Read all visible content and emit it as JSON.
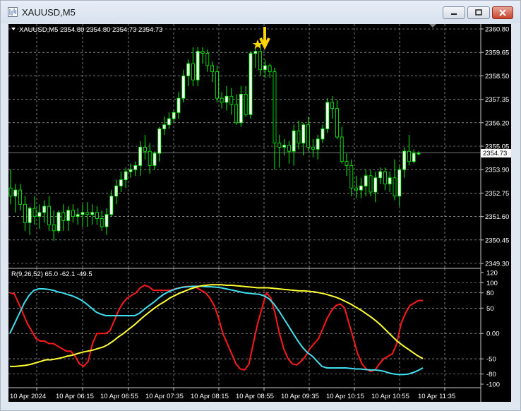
{
  "window": {
    "title": "XAUUSD,M5"
  },
  "info_line": "XAUUSD,M5  2354.80 2354.80 2354.73 2354.73",
  "indicator_label": "R(9,26,52) 65.0 -62.1 -49.5",
  "current_price": "2354.73",
  "colors": {
    "bull": "#ffffff",
    "bear": "#000000",
    "wick": "#00ff00",
    "grid": "#c8c8c8",
    "red_line": "#ff1a1a",
    "cyan_line": "#40e0f0",
    "yellow_line": "#ffff33",
    "marker": "#ffd400"
  },
  "chart_data": [
    {
      "type": "candlestick",
      "symbol": "XAUUSD",
      "timeframe": "M5",
      "y_ticks": [
        "2360.80",
        "2359.65",
        "2358.50",
        "2357.35",
        "2356.20",
        "2355.05",
        "2353.90",
        "2352.75",
        "2351.60",
        "2350.45",
        "2349.30"
      ],
      "ylim": [
        2349.3,
        2360.8
      ],
      "x_ticks": [
        "10 Apr 2024",
        "10 Apr 06:15",
        "10 Apr 06:55",
        "10 Apr 07:35",
        "10 Apr 08:15",
        "10 Apr 08:55",
        "10 Apr 09:35",
        "10 Apr 10:15",
        "10 Apr 10:55",
        "10 Apr 11:35"
      ],
      "candles": [
        [
          2353.0,
          2353.9,
          2352.2,
          2352.6
        ],
        [
          2352.6,
          2353.2,
          2351.8,
          2352.9
        ],
        [
          2352.9,
          2353.2,
          2351.9,
          2352.2
        ],
        [
          2352.2,
          2352.6,
          2350.9,
          2351.3
        ],
        [
          2351.3,
          2352.1,
          2350.7,
          2352.0
        ],
        [
          2352.0,
          2352.6,
          2351.2,
          2351.6
        ],
        [
          2351.6,
          2352.2,
          2351.0,
          2351.8
        ],
        [
          2351.8,
          2352.4,
          2351.3,
          2352.1
        ],
        [
          2352.1,
          2352.6,
          2350.9,
          2351.2
        ],
        [
          2351.2,
          2351.9,
          2350.4,
          2350.9
        ],
        [
          2350.9,
          2351.9,
          2350.8,
          2351.8
        ],
        [
          2351.8,
          2352.2,
          2350.9,
          2351.4
        ],
        [
          2351.4,
          2352.1,
          2350.9,
          2351.9
        ],
        [
          2351.9,
          2352.2,
          2351.3,
          2351.6
        ],
        [
          2351.6,
          2352.0,
          2351.2,
          2351.7
        ],
        [
          2351.7,
          2352.2,
          2351.1,
          2351.8
        ],
        [
          2351.8,
          2352.3,
          2351.1,
          2351.7
        ],
        [
          2351.7,
          2352.2,
          2351.2,
          2351.8
        ],
        [
          2351.8,
          2352.1,
          2351.2,
          2351.5
        ],
        [
          2351.5,
          2351.9,
          2350.9,
          2351.1
        ],
        [
          2351.1,
          2352.0,
          2350.7,
          2351.7
        ],
        [
          2351.7,
          2352.9,
          2351.6,
          2352.6
        ],
        [
          2352.6,
          2353.4,
          2352.2,
          2353.1
        ],
        [
          2353.1,
          2353.8,
          2352.8,
          2353.4
        ],
        [
          2353.4,
          2354.0,
          2353.0,
          2353.8
        ],
        [
          2353.8,
          2354.2,
          2353.5,
          2353.9
        ],
        [
          2353.9,
          2354.3,
          2353.6,
          2354.1
        ],
        [
          2354.1,
          2355.3,
          2353.6,
          2355.0
        ],
        [
          2355.0,
          2355.6,
          2354.4,
          2354.8
        ],
        [
          2354.8,
          2355.2,
          2353.7,
          2354.1
        ],
        [
          2354.1,
          2354.8,
          2353.9,
          2354.7
        ],
        [
          2354.7,
          2356.0,
          2354.3,
          2355.9
        ],
        [
          2355.9,
          2356.5,
          2355.6,
          2356.1
        ],
        [
          2356.1,
          2356.7,
          2355.9,
          2356.4
        ],
        [
          2356.4,
          2356.8,
          2356.2,
          2356.7
        ],
        [
          2356.7,
          2357.7,
          2356.4,
          2357.4
        ],
        [
          2357.4,
          2358.8,
          2357.2,
          2358.5
        ],
        [
          2358.5,
          2359.3,
          2358.0,
          2359.1
        ],
        [
          2359.1,
          2359.9,
          2358.0,
          2358.3
        ],
        [
          2358.3,
          2359.9,
          2358.0,
          2359.7
        ],
        [
          2359.7,
          2359.9,
          2359.1,
          2359.6
        ],
        [
          2359.6,
          2359.8,
          2358.7,
          2359.0
        ],
        [
          2359.0,
          2359.2,
          2358.2,
          2358.7
        ],
        [
          2358.7,
          2359.0,
          2357.2,
          2357.4
        ],
        [
          2357.4,
          2357.7,
          2356.9,
          2357.2
        ],
        [
          2357.2,
          2358.0,
          2356.8,
          2357.5
        ],
        [
          2357.5,
          2357.9,
          2356.6,
          2357.1
        ],
        [
          2357.1,
          2357.6,
          2356.1,
          2356.2
        ],
        [
          2356.2,
          2358.0,
          2356.0,
          2357.6
        ],
        [
          2357.6,
          2358.0,
          2356.5,
          2356.6
        ],
        [
          2356.6,
          2359.7,
          2356.4,
          2359.6
        ],
        [
          2359.6,
          2359.9,
          2358.9,
          2359.7
        ],
        [
          2359.7,
          2360.1,
          2358.5,
          2358.8
        ],
        [
          2358.8,
          2359.3,
          2358.4,
          2359.0
        ],
        [
          2359.0,
          2359.1,
          2358.4,
          2358.7
        ],
        [
          2358.7,
          2358.9,
          2353.9,
          2355.2
        ],
        [
          2355.2,
          2355.6,
          2354.0,
          2355.0
        ],
        [
          2355.0,
          2355.4,
          2354.6,
          2355.1
        ],
        [
          2355.1,
          2355.3,
          2354.2,
          2354.8
        ],
        [
          2354.8,
          2356.1,
          2354.1,
          2355.8
        ],
        [
          2355.8,
          2356.3,
          2354.9,
          2355.2
        ],
        [
          2355.2,
          2356.2,
          2354.6,
          2356.1
        ],
        [
          2356.1,
          2356.5,
          2354.8,
          2355.0
        ],
        [
          2355.0,
          2355.4,
          2354.5,
          2354.9
        ],
        [
          2354.9,
          2355.6,
          2354.4,
          2355.4
        ],
        [
          2355.4,
          2356.1,
          2355.2,
          2355.9
        ],
        [
          2355.9,
          2357.4,
          2355.7,
          2357.2
        ],
        [
          2357.2,
          2357.5,
          2356.4,
          2356.9
        ],
        [
          2356.9,
          2357.3,
          2355.4,
          2355.5
        ],
        [
          2355.5,
          2356.0,
          2354.2,
          2354.3
        ],
        [
          2354.3,
          2354.7,
          2353.6,
          2354.1
        ],
        [
          2354.1,
          2354.4,
          2352.6,
          2353.0
        ],
        [
          2353.0,
          2353.6,
          2352.5,
          2352.9
        ],
        [
          2352.9,
          2353.5,
          2352.5,
          2353.1
        ],
        [
          2353.1,
          2353.9,
          2352.6,
          2353.6
        ],
        [
          2353.6,
          2353.9,
          2352.6,
          2352.8
        ],
        [
          2352.8,
          2353.8,
          2352.3,
          2353.5
        ],
        [
          2353.5,
          2354.0,
          2353.2,
          2353.8
        ],
        [
          2353.8,
          2354.0,
          2352.9,
          2353.2
        ],
        [
          2353.2,
          2353.8,
          2352.8,
          2353.5
        ],
        [
          2353.5,
          2354.4,
          2352.4,
          2352.6
        ],
        [
          2352.6,
          2354.1,
          2352.1,
          2353.9
        ],
        [
          2353.9,
          2355.0,
          2353.5,
          2354.8
        ],
        [
          2354.8,
          2355.6,
          2354.1,
          2354.3
        ],
        [
          2354.3,
          2354.9,
          2354.2,
          2354.7
        ],
        [
          2354.7,
          2354.8,
          2354.6,
          2354.7
        ]
      ]
    },
    {
      "type": "line",
      "ylim": [
        -100,
        120
      ],
      "y_ticks": [
        "120",
        "100",
        "80",
        "50",
        "0.00",
        "-50",
        "-80",
        "-100"
      ],
      "y_tick_values": [
        120,
        100,
        80,
        50,
        0,
        -50,
        -80,
        -100
      ],
      "series": [
        {
          "color": "red",
          "values": [
            80,
            78,
            60,
            40,
            20,
            5,
            -10,
            -15,
            -15,
            -20,
            -20,
            -25,
            -30,
            -35,
            -35,
            -45,
            -60,
            -65,
            -55,
            -20,
            0,
            0,
            0,
            5,
            25,
            45,
            60,
            70,
            75,
            80,
            90,
            95,
            92,
            85,
            85,
            85,
            85,
            85,
            88,
            90,
            92,
            93,
            92,
            90,
            85,
            80,
            70,
            55,
            30,
            0,
            -20,
            -40,
            -60,
            -70,
            -72,
            -60,
            -20,
            20,
            50,
            80,
            70,
            40,
            0,
            -30,
            -50,
            -60,
            -62,
            -55,
            -45,
            -30,
            -20,
            -10,
            10,
            30,
            45,
            55,
            58,
            50,
            20,
            -10,
            -40,
            -60,
            -70,
            -75,
            -72,
            -60,
            -50,
            -45,
            -40,
            -20,
            20,
            40,
            55,
            60,
            65,
            65
          ]
        },
        {
          "color": "cyan",
          "values": [
            0,
            20,
            40,
            60,
            75,
            85,
            88,
            88,
            87,
            85,
            82,
            80,
            77,
            74,
            70,
            65,
            58,
            50,
            42,
            38,
            35,
            35,
            35,
            35,
            35,
            35,
            35,
            40,
            48,
            55,
            62,
            70,
            77,
            82,
            86,
            89,
            91,
            92,
            93,
            93,
            93,
            92,
            92,
            91,
            90,
            88,
            86,
            84,
            82,
            80,
            79,
            78,
            77,
            74,
            68,
            58,
            45,
            30,
            15,
            0,
            -15,
            -28,
            -38,
            -45,
            -55,
            -65,
            -68,
            -68,
            -68,
            -68,
            -68,
            -69,
            -70,
            -70,
            -71,
            -72,
            -72,
            -73,
            -75,
            -78,
            -80,
            -81,
            -81,
            -80,
            -77,
            -73,
            -68
          ]
        },
        {
          "color": "yellow",
          "values": [
            -65,
            -65,
            -64,
            -63,
            -61,
            -58,
            -55,
            -52,
            -52,
            -50,
            -48,
            -45,
            -43,
            -40,
            -37,
            -35,
            -33,
            -30,
            -27,
            -22,
            -15,
            -7,
            0,
            8,
            16,
            25,
            34,
            42,
            50,
            57,
            63,
            70,
            75,
            80,
            84,
            88,
            91,
            94,
            95,
            96,
            96,
            96,
            95,
            95,
            94,
            93,
            92,
            91,
            90,
            90,
            90,
            89,
            88,
            87,
            86,
            85,
            84,
            84,
            83,
            82,
            80,
            78,
            75,
            72,
            68,
            63,
            58,
            52,
            46,
            39,
            32,
            24,
            15,
            5,
            -5,
            -15,
            -23,
            -30,
            -37,
            -44,
            -49.5
          ]
        }
      ]
    }
  ]
}
